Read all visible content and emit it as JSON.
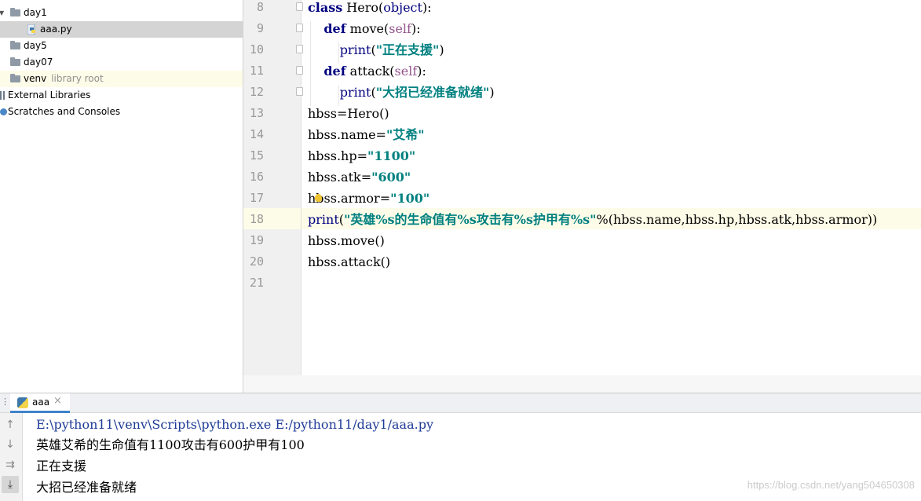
{
  "project_tree": {
    "items": [
      {
        "label": "day1",
        "sub": "",
        "kind": "folder",
        "expanded": true
      },
      {
        "label": "aaa.py",
        "sub": "",
        "kind": "python-file",
        "selected": true
      },
      {
        "label": "day5",
        "sub": "",
        "kind": "folder"
      },
      {
        "label": "day07",
        "sub": "",
        "kind": "folder"
      },
      {
        "label": "venv",
        "sub": "library root",
        "kind": "folder"
      },
      {
        "label": "External Libraries",
        "sub": "",
        "kind": "libraries"
      },
      {
        "label": "Scratches and Consoles",
        "sub": "",
        "kind": "scratches"
      }
    ]
  },
  "editor": {
    "line_numbers": [
      "8",
      "9",
      "10",
      "11",
      "12",
      "13",
      "14",
      "15",
      "16",
      "17",
      "18",
      "19",
      "20",
      "21"
    ],
    "current_line": "18",
    "lines": [
      [
        {
          "t": "class",
          "c": "kw"
        },
        {
          "t": " Hero(",
          "c": ""
        },
        {
          "t": "object",
          "c": "bi"
        },
        {
          "t": "):",
          "c": ""
        }
      ],
      [
        {
          "t": "    ",
          "c": ""
        },
        {
          "t": "def",
          "c": "kw"
        },
        {
          "t": " move(",
          "c": ""
        },
        {
          "t": "self",
          "c": "slf"
        },
        {
          "t": "):",
          "c": ""
        }
      ],
      [
        {
          "t": "        ",
          "c": ""
        },
        {
          "t": "print",
          "c": "bi"
        },
        {
          "t": "(",
          "c": ""
        },
        {
          "t": "\"正在支援\"",
          "c": "str"
        },
        {
          "t": ")",
          "c": ""
        }
      ],
      [
        {
          "t": "    ",
          "c": ""
        },
        {
          "t": "def",
          "c": "kw"
        },
        {
          "t": " attack(",
          "c": ""
        },
        {
          "t": "self",
          "c": "slf"
        },
        {
          "t": "):",
          "c": ""
        }
      ],
      [
        {
          "t": "        ",
          "c": ""
        },
        {
          "t": "print",
          "c": "bi"
        },
        {
          "t": "(",
          "c": ""
        },
        {
          "t": "\"大招已经准备就绪\"",
          "c": "str"
        },
        {
          "t": ")",
          "c": ""
        }
      ],
      [
        {
          "t": "hbss=Hero()",
          "c": ""
        }
      ],
      [
        {
          "t": "hbss.name=",
          "c": ""
        },
        {
          "t": "\"艾希\"",
          "c": "str"
        }
      ],
      [
        {
          "t": "hbss.hp=",
          "c": ""
        },
        {
          "t": "\"1100\"",
          "c": "str"
        }
      ],
      [
        {
          "t": "hbss.atk=",
          "c": ""
        },
        {
          "t": "\"600\"",
          "c": "str"
        }
      ],
      [
        {
          "t": "hbss.armor=",
          "c": ""
        },
        {
          "t": "\"100\"",
          "c": "str"
        }
      ],
      [
        {
          "t": "print",
          "c": "bi"
        },
        {
          "t": "(",
          "c": ""
        },
        {
          "t": "\"英雄%s的生命值有%s攻击有%s护甲有%s\"",
          "c": "str"
        },
        {
          "t": "%(hbss.name,hbss.hp,hbss.atk,hbss.armor))",
          "c": ""
        }
      ],
      [
        {
          "t": "hbss.move()",
          "c": ""
        }
      ],
      [
        {
          "t": "hbss.attack()",
          "c": ""
        }
      ],
      [
        {
          "t": "",
          "c": ""
        }
      ]
    ]
  },
  "run_panel": {
    "tab_label": "aaa",
    "tab_close": "×",
    "tools": [
      {
        "icon": "up-arrow-icon",
        "glyph": "↑"
      },
      {
        "icon": "down-arrow-icon",
        "glyph": "↓"
      },
      {
        "icon": "soft-wrap-icon",
        "glyph": "⇉"
      },
      {
        "icon": "scroll-to-end-icon",
        "glyph": "⤓"
      }
    ],
    "console_lines": [
      {
        "text": "E:\\python11\\venv\\Scripts\\python.exe E:/python11/day1/aaa.py",
        "kind": "cmd"
      },
      {
        "text": "英雄艾希的生命值有1100攻击有600护甲有100",
        "kind": "out"
      },
      {
        "text": "正在支援",
        "kind": "out"
      },
      {
        "text": "大招已经准备就绪",
        "kind": "out"
      }
    ]
  },
  "watermark": "https://blog.csdn.net/yang504650308",
  "colors": {
    "keyword": "#000080",
    "string": "#008080",
    "self": "#94558d",
    "current_line": "#fdfce8",
    "selection": "#d4d4d4",
    "tab_underline": "#4083c9"
  }
}
